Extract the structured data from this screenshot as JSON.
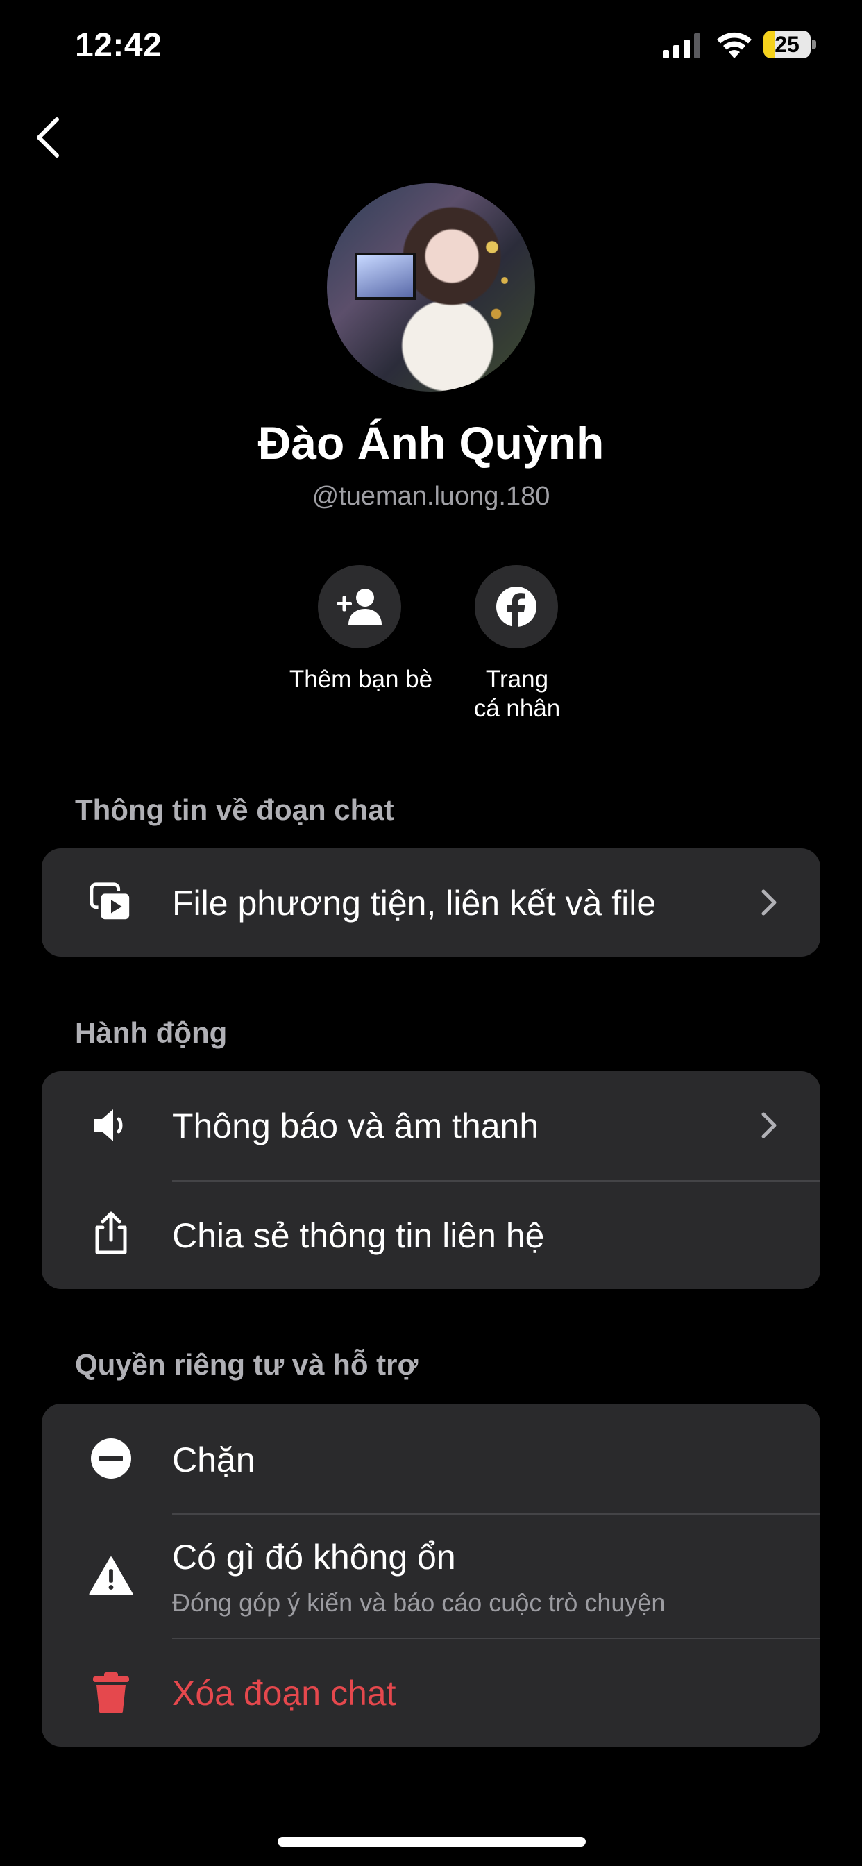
{
  "status_bar": {
    "time": "12:42",
    "battery_level": "25",
    "battery_fraction": 0.25,
    "battery_color": "#f5d21c"
  },
  "profile": {
    "name": "Đào Ánh Quỳnh",
    "handle": "@tueman.luong.180"
  },
  "actions": {
    "add_friend_label": "Thêm bạn bè",
    "profile_label_line1": "Trang",
    "profile_label_line2": "cá nhân"
  },
  "sections": {
    "chat_info": {
      "title": "Thông tin về đoạn chat",
      "media_label": "File phương tiện, liên kết và file"
    },
    "actions": {
      "title": "Hành động",
      "notifications_label": "Thông báo và âm thanh",
      "share_contact_label": "Chia sẻ thông tin liên hệ"
    },
    "privacy": {
      "title": "Quyền riêng tư và hỗ trợ",
      "block_label": "Chặn",
      "report_label": "Có gì đó không ổn",
      "report_sub": "Đóng góp ý kiến và báo cáo cuộc trò chuyện",
      "delete_label": "Xóa đoạn chat",
      "delete_color": "#e5484d"
    }
  },
  "icons": {
    "back": "chevron-left-icon",
    "add_friend": "person-add-icon",
    "facebook": "facebook-icon",
    "media": "media-files-icon",
    "notifications": "speaker-icon",
    "share": "share-icon",
    "block": "block-icon",
    "report": "warning-icon",
    "delete": "trash-icon"
  }
}
